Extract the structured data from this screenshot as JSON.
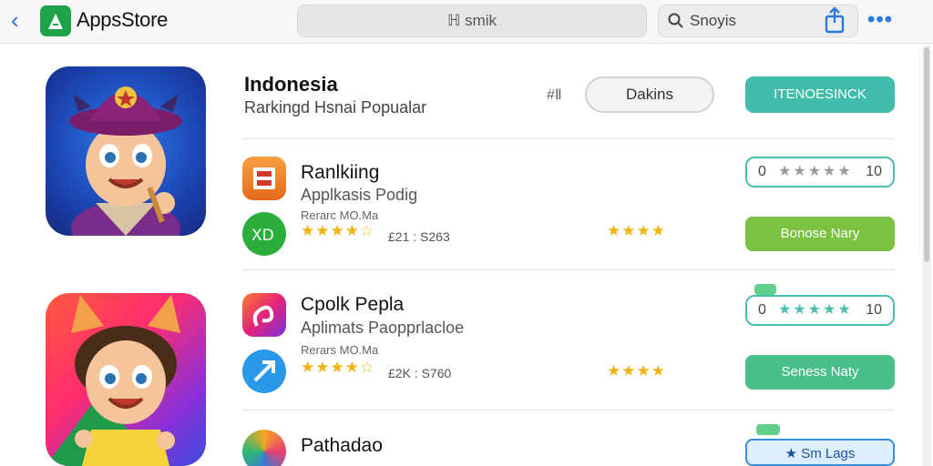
{
  "toolbar": {
    "back": "‹",
    "brand": "AppsStore",
    "search_center": "ℍ smik",
    "search_right": "Snoyis",
    "more": "•••"
  },
  "header": {
    "title": "Indonesia",
    "subtitle": "Rarkingd Hsnai Popualar",
    "hash": "#Ⅱ",
    "pill_outline": "Dakins",
    "pill_teal": "ITENOESINCK"
  },
  "apps": [
    {
      "name": "Ranlkiing",
      "sub": "Applkasis Podig",
      "small": "Rerarc MO.Ma",
      "stars": "★★★★☆",
      "price": "£21 : S263",
      "stars2": "★★★★",
      "rating_left": "0",
      "rating_stars": "★★★★★",
      "rating_right": "10",
      "button": "Bonose Nary"
    },
    {
      "name": "Cpolk Pepla",
      "sub": "Aplimats Paopprlacloe",
      "small": "Rerars MO.Ma",
      "stars": "★★★★☆",
      "price": "£2K : S760",
      "stars2": "★★★★",
      "rating_left": "0",
      "rating_stars": "★★★★★",
      "rating_right": "10",
      "button": "Seness Naty"
    },
    {
      "name": "Pathadao",
      "button": "Sm Lags"
    }
  ],
  "colors": {
    "accent_blue": "#2a7ae2",
    "teal": "#3fbdaa",
    "green": "#7cc242",
    "star": "#f2b310"
  }
}
